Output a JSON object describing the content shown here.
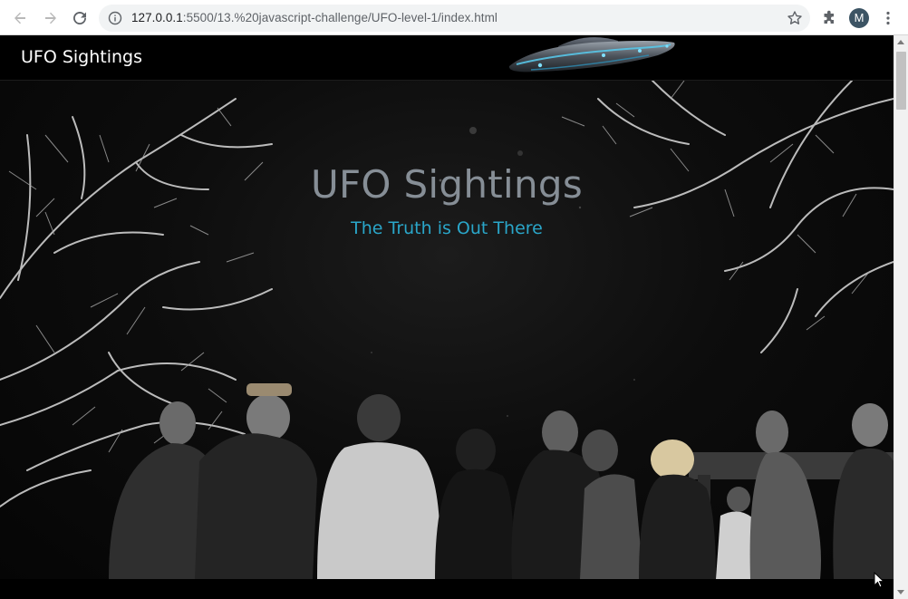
{
  "browser": {
    "url_host": "127.0.0.1",
    "url_rest": ":5500/13.%20javascript-challenge/UFO-level-1/index.html",
    "profile_initial": "M"
  },
  "page": {
    "brand": "UFO Sightings",
    "hero_title": "UFO Sightings",
    "hero_subtitle": "The Truth is Out There"
  },
  "colors": {
    "hero_title": "#868e96",
    "hero_subtitle": "#2aa6c9",
    "navbar_bg": "#000000"
  },
  "icons": [
    "back-arrow-icon",
    "forward-arrow-icon",
    "reload-icon",
    "info-icon",
    "star-icon",
    "extensions-icon",
    "menu-dots-icon",
    "ufo-logo"
  ]
}
